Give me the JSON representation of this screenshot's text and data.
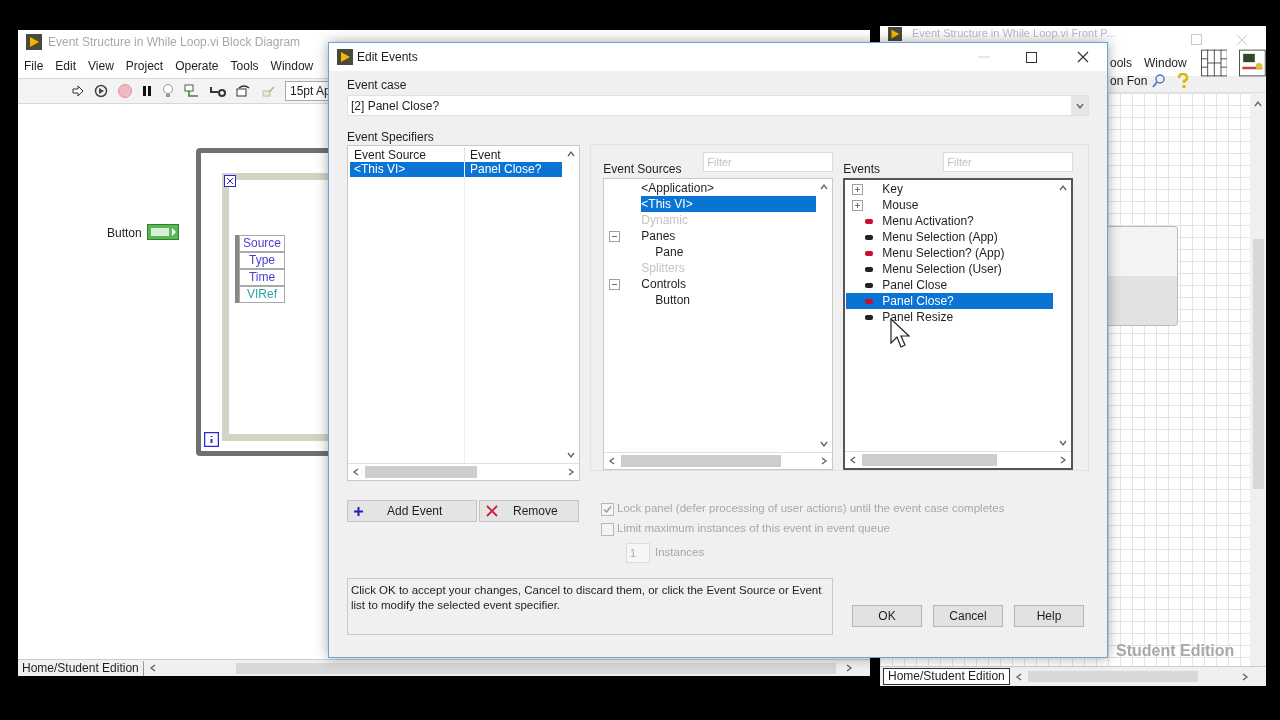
{
  "block_diagram_window": {
    "title": "Event Structure in While Loop.vi Block Diagram",
    "menu": [
      "File",
      "Edit",
      "View",
      "Project",
      "Operate",
      "Tools",
      "Window"
    ],
    "font_box": "15pt Ap",
    "control_label": "Button",
    "event_data_node": [
      {
        "label": "Source",
        "color": "#4a3fd0"
      },
      {
        "label": "Type",
        "color": "#4a3fd0"
      },
      {
        "label": "Time",
        "color": "#4a3fd0"
      },
      {
        "label": "VIRef",
        "color": "#2aa3a3"
      }
    ],
    "status": "Home/Student Edition"
  },
  "front_panel_window": {
    "title": "Event Structure in While Loop.vi Front P...",
    "menu": [
      "ools",
      "Window"
    ],
    "font_box": "on Fon",
    "watermark": "Student Edition",
    "status": "Home/Student Edition"
  },
  "dialog": {
    "title": "Edit Events",
    "event_case_label": "Event case",
    "event_case": "[2] Panel Close?",
    "specifiers_label": "Event Specifiers",
    "specifier_columns": [
      "Event Source",
      "Event"
    ],
    "specifiers": [
      {
        "source": "<This VI>",
        "event": "Panel Close?",
        "selected": true
      }
    ],
    "sources_label": "Event Sources",
    "sources_filter": {
      "placeholder": "Filter"
    },
    "sources": [
      {
        "label": "<Application>",
        "selected": false,
        "disabled": false
      },
      {
        "label": "<This VI>",
        "selected": true,
        "disabled": false
      },
      {
        "label": "Dynamic",
        "selected": false,
        "disabled": true
      },
      {
        "label": "Panes",
        "selected": false,
        "disabled": false,
        "expanded": true,
        "children": [
          {
            "label": "Pane",
            "selected": false,
            "disabled": false
          }
        ]
      },
      {
        "label": "Splitters",
        "selected": false,
        "disabled": true
      },
      {
        "label": "Controls",
        "selected": false,
        "disabled": false,
        "expanded": true,
        "children": [
          {
            "label": "Button",
            "selected": false,
            "disabled": false
          }
        ]
      }
    ],
    "events_label": "Events",
    "events_filter": {
      "placeholder": "Filter"
    },
    "events": [
      {
        "kind": "category",
        "label": "Key",
        "selected": false,
        "expanded": false
      },
      {
        "kind": "category",
        "label": "Mouse",
        "selected": false,
        "expanded": false
      },
      {
        "kind": "event",
        "label": "Menu Activation?",
        "selected": false,
        "color": "#c8102e"
      },
      {
        "kind": "event",
        "label": "Menu Selection (App)",
        "selected": false,
        "color": "#222222"
      },
      {
        "kind": "event",
        "label": "Menu Selection? (App)",
        "selected": false,
        "color": "#c8102e"
      },
      {
        "kind": "event",
        "label": "Menu Selection (User)",
        "selected": false,
        "color": "#222222"
      },
      {
        "kind": "event",
        "label": "Panel Close",
        "selected": false,
        "color": "#222222"
      },
      {
        "kind": "event",
        "label": "Panel Close?",
        "selected": true,
        "color": "#c8102e"
      },
      {
        "kind": "event",
        "label": "Panel Resize",
        "selected": false,
        "color": "#222222"
      }
    ],
    "add_button": "Add Event",
    "remove_button": "Remove",
    "options": [
      {
        "label": "Lock panel (defer processing of user actions) until the event case completes",
        "checked": true,
        "disabled": true
      },
      {
        "label": "Limit maximum instances of this event in event queue",
        "checked": false,
        "disabled": true
      }
    ],
    "instances": {
      "value": "1",
      "label": "Instances",
      "disabled": true
    },
    "help_text": "Click OK to accept your changes, Cancel to discard them, or click the Event Source or Event list to modify the selected event specifier.",
    "buttons": [
      "OK",
      "Cancel",
      "Help"
    ]
  }
}
